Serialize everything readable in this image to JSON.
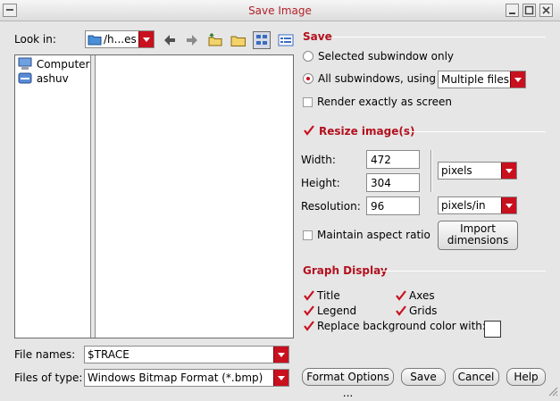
{
  "window": {
    "title": "Save Image"
  },
  "file_browser": {
    "look_in_label": "Look in:",
    "look_in_value": "/h...es",
    "tree_items": [
      {
        "label": "Computer",
        "icon": "computer-icon"
      },
      {
        "label": "ashuv",
        "icon": "drive-icon"
      }
    ],
    "file_names_label": "File names:",
    "file_names_value": "$TRACE",
    "files_of_type_label": "Files of type:",
    "files_of_type_value": "Windows Bitmap Format (*.bmp)"
  },
  "save": {
    "title": "Save",
    "opt_selected": "Selected subwindow only",
    "opt_all": "All subwindows, using",
    "all_mode_value": "Multiple files",
    "render_exact": "Render exactly as screen",
    "selected_option": "all"
  },
  "resize": {
    "title": "Resize image(s)",
    "checked": true,
    "width_label": "Width:",
    "width_value": "472",
    "height_label": "Height:",
    "height_value": "304",
    "units_value": "pixels",
    "resolution_label": "Resolution:",
    "resolution_value": "96",
    "resolution_units_value": "pixels/in",
    "maintain_aspect_label": "Maintain aspect ratio",
    "maintain_aspect_checked": false,
    "import_label_line1": "Import",
    "import_label_line2": "dimensions"
  },
  "graph_display": {
    "title": "Graph Display",
    "title_opt": "Title",
    "axes_opt": "Axes",
    "legend_opt": "Legend",
    "grids_opt": "Grids",
    "replace_bg": "Replace background color with:",
    "bg_color": "#ffffff"
  },
  "buttons": {
    "format_options": "Format Options ...",
    "save": "Save",
    "cancel": "Cancel",
    "help": "Help"
  },
  "colors": {
    "accent": "#c8101e",
    "title_text": "#b3202a"
  }
}
